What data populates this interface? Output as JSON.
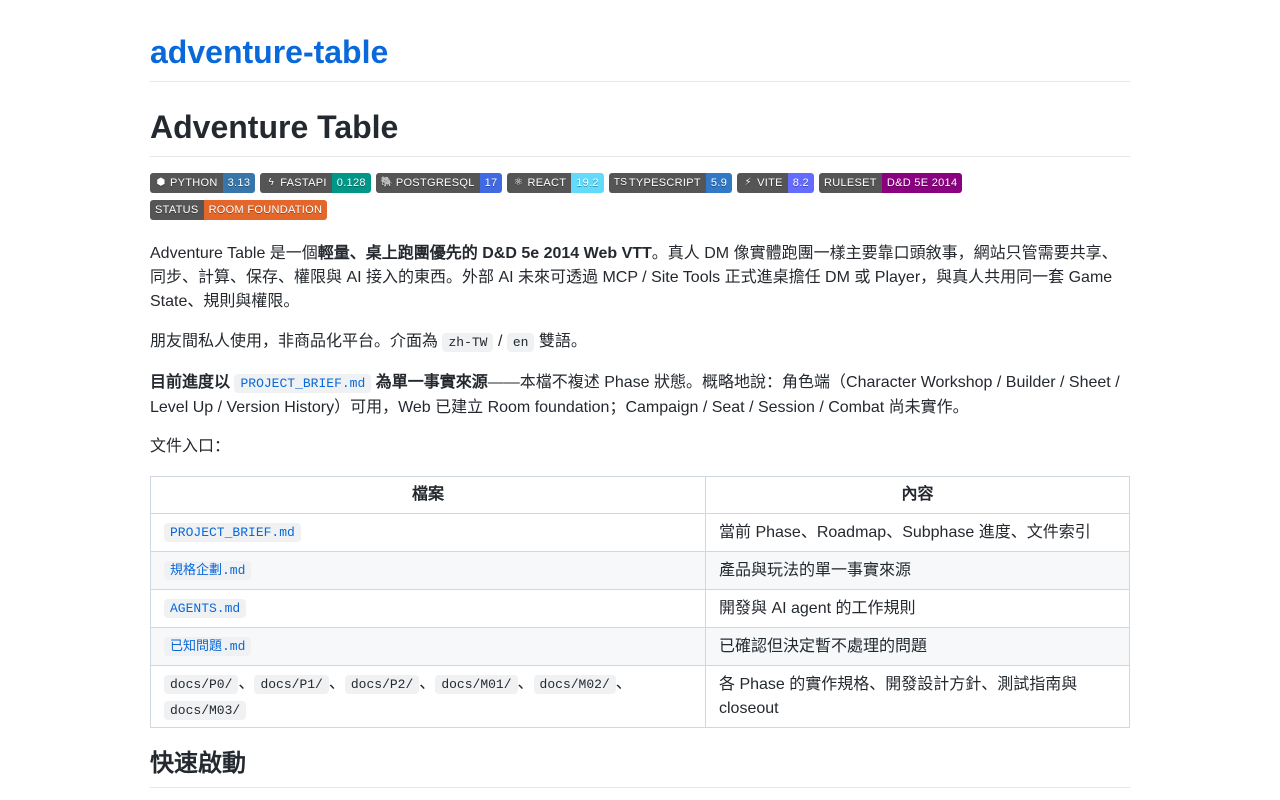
{
  "site": {
    "title": "adventure-table"
  },
  "page": {
    "title": "Adventure Table"
  },
  "badges": [
    {
      "label": "PYTHON",
      "value": "3.13",
      "icon": "python-icon",
      "glyph": "⬢",
      "color": "#3776ab"
    },
    {
      "label": "FASTAPI",
      "value": "0.128",
      "icon": "fastapi-icon",
      "glyph": "ϟ",
      "color": "#009688"
    },
    {
      "label": "POSTGRESQL",
      "value": "17",
      "icon": "postgresql-icon",
      "glyph": "🐘",
      "color": "#4169e1"
    },
    {
      "label": "REACT",
      "value": "19.2",
      "icon": "react-icon",
      "glyph": "⚛",
      "color": "#61dafb"
    },
    {
      "label": "TYPESCRIPT",
      "value": "5.9",
      "icon": "typescript-icon",
      "glyph": "TS",
      "color": "#3178c6"
    },
    {
      "label": "VITE",
      "value": "8.2",
      "icon": "vite-icon",
      "glyph": "⚡",
      "color": "#646cff"
    },
    {
      "label": "RULESET",
      "value": "D&D 5E 2014",
      "icon": "",
      "glyph": "",
      "color": "#8b0080"
    },
    {
      "label": "STATUS",
      "value": "ROOM FOUNDATION",
      "icon": "",
      "glyph": "",
      "color": "#e3672b"
    }
  ],
  "intro": {
    "p1_a": "Adventure Table 是一個",
    "p1_b": "輕量、桌上跑團優先的 D&D 5e 2014 Web VTT",
    "p1_c": "。真人 DM 像實體跑團一樣主要靠口頭敘事，網站只管需要共享、同步、計算、保存、權限與 AI 接入的東西。外部 AI 未來可透過 MCP / Site Tools 正式進桌擔任 DM 或 Player，與真人共用同一套 Game State、規則與權限。",
    "p2_a": "朋友間私人使用，非商品化平台。介面為",
    "p2_code1": "zh-TW",
    "p2_sep": "/",
    "p2_code2": "en",
    "p2_b": "雙語。",
    "p3_a": "目前進度以",
    "p3_link": "PROJECT_BRIEF.md",
    "p3_b": "為單一事實來源",
    "p3_c": "——本檔不複述 Phase 狀態。概略地說：角色端（Character Workshop / Builder / Sheet / Level Up / Version History）可用，Web 已建立 Room foundation；Campaign / Seat / Session / Combat 尚未實作。",
    "p4": "文件入口："
  },
  "table": {
    "headers": [
      "檔案",
      "內容"
    ],
    "rows": [
      {
        "file": "PROJECT_BRIEF.md",
        "desc": "當前 Phase、Roadmap、Subphase 進度、文件索引"
      },
      {
        "file": "規格企劃.md",
        "desc": "產品與玩法的單一事實來源"
      },
      {
        "file": "AGENTS.md",
        "desc": "開發與 AI agent 的工作規則"
      },
      {
        "file": "已知問題.md",
        "desc": "已確認但決定暫不處理的問題"
      }
    ],
    "last_row": {
      "dirs": [
        "docs/P0/",
        "docs/P1/",
        "docs/P2/",
        "docs/M01/",
        "docs/M02/",
        "docs/M03/"
      ],
      "sep": "、",
      "desc": "各 Phase 的實作規格、開發設計方針、測試指南與 closeout"
    }
  },
  "section": {
    "quickstart": "快速啟動"
  }
}
